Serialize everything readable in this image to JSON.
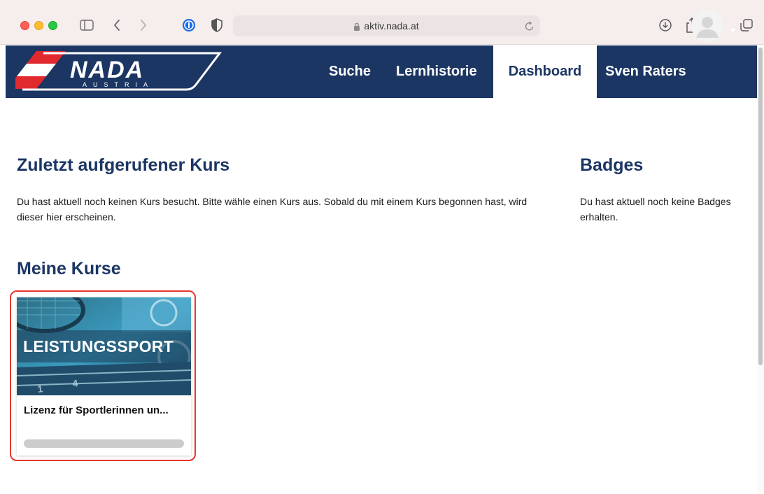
{
  "browser": {
    "url": "aktiv.nada.at"
  },
  "logo": {
    "brand": "NADA",
    "sub": "AUSTRIA"
  },
  "nav": {
    "search": "Suche",
    "history": "Lernhistorie",
    "dashboard": "Dashboard",
    "user_name": "Sven Raters"
  },
  "recent": {
    "title": "Zuletzt aufgerufener Kurs",
    "text": "Du hast aktuell noch keinen Kurs besucht. Bitte wähle einen Kurs aus. Sobald du mit einem Kurs begonnen hast, wird dieser hier erscheinen."
  },
  "badges": {
    "title": "Badges",
    "text": "Du hast aktuell noch keine Badges erhalten."
  },
  "courses": {
    "title": "Meine Kurse",
    "items": [
      {
        "image_label": "LEISTUNGSSPORT",
        "title": "Lizenz für Sportlerinnen un...",
        "progress": 0
      }
    ]
  },
  "colors": {
    "navy": "#1c3664",
    "highlight": "#e8382f"
  }
}
